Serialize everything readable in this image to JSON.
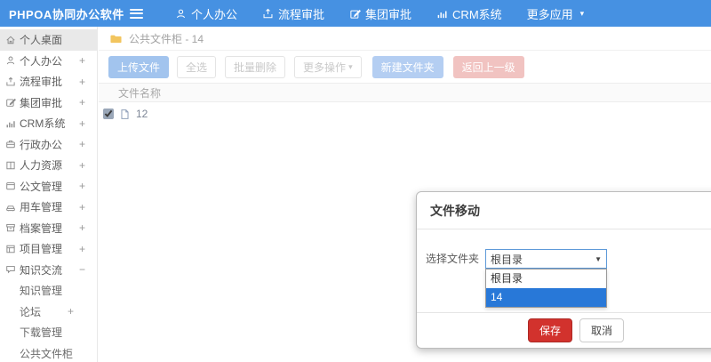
{
  "header": {
    "logo": "PHPOA协同办公软件",
    "nav": [
      {
        "label": "个人办公",
        "icon": "user-icon"
      },
      {
        "label": "流程审批",
        "icon": "process-icon"
      },
      {
        "label": "集团审批",
        "icon": "edit-icon"
      },
      {
        "label": "CRM系统",
        "icon": "chart-icon"
      },
      {
        "label": "更多应用",
        "icon": "caret-down-icon",
        "caret": true
      }
    ]
  },
  "sidebar": {
    "items": [
      {
        "label": "个人桌面",
        "icon": "home-icon",
        "active": true
      },
      {
        "label": "个人办公",
        "icon": "user-icon",
        "expand": "+"
      },
      {
        "label": "流程审批",
        "icon": "process-icon",
        "expand": "+"
      },
      {
        "label": "集团审批",
        "icon": "edit-icon",
        "expand": "+"
      },
      {
        "label": "CRM系统",
        "icon": "chart-icon",
        "expand": "+"
      },
      {
        "label": "行政办公",
        "icon": "briefcase-icon",
        "expand": "+"
      },
      {
        "label": "人力资源",
        "icon": "book-icon",
        "expand": "+"
      },
      {
        "label": "公文管理",
        "icon": "doc-icon",
        "expand": "+"
      },
      {
        "label": "用车管理",
        "icon": "car-icon",
        "expand": "+"
      },
      {
        "label": "档案管理",
        "icon": "archive-icon",
        "expand": "+"
      },
      {
        "label": "项目管理",
        "icon": "project-icon",
        "expand": "+"
      },
      {
        "label": "知识交流",
        "icon": "chat-icon",
        "expand": "−",
        "expanded": true
      },
      {
        "label": "知识管理",
        "sub": true
      },
      {
        "label": "论坛",
        "sub": true,
        "expand": "+"
      },
      {
        "label": "下载管理",
        "sub": true
      },
      {
        "label": "公共文件柜",
        "sub": true
      }
    ]
  },
  "main": {
    "breadcrumb": "公共文件柜 - 14",
    "folder_icon": "folder-icon",
    "toolbar": {
      "upload": "上传文件",
      "select_all": "全选",
      "batch_delete": "批量删除",
      "more_actions": "更多操作",
      "new_folder": "新建文件夹",
      "back": "返回上一级"
    },
    "table": {
      "name_header": "文件名称",
      "rows": [
        {
          "name": "12",
          "checked": true,
          "icon": "file-icon"
        }
      ]
    }
  },
  "modal": {
    "title": "文件移动",
    "field_label": "选择文件夹",
    "select_value": "根目录",
    "options": [
      {
        "label": "根目录",
        "selected": false
      },
      {
        "label": "14",
        "selected": true
      }
    ],
    "save_label": "保存",
    "cancel_label": "取消"
  },
  "colors": {
    "header_bg": "#4691e2",
    "upload_btn_bg": "#a2c4ee",
    "new_folder_btn_bg": "#b4cef2",
    "back_btn_bg": "#f1c3c1",
    "save_btn_bg": "#d2322d",
    "option_highlight_bg": "#2878d8",
    "folder_icon_color": "#f2c55e"
  }
}
